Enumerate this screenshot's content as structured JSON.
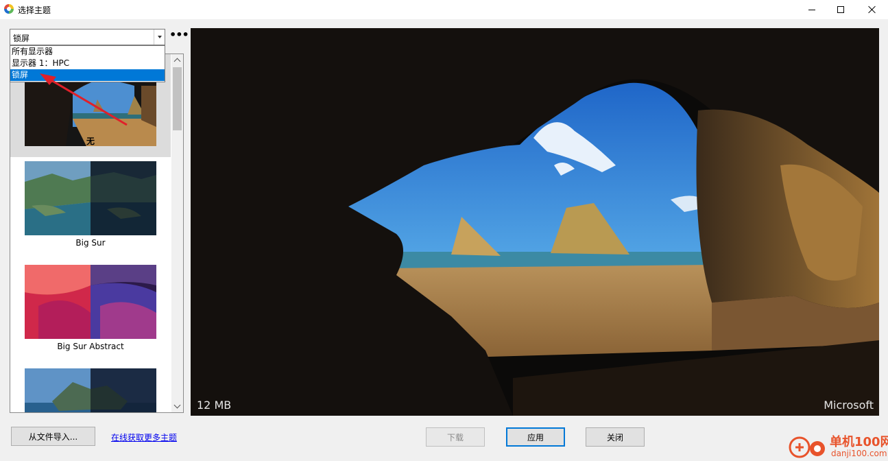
{
  "window": {
    "title": "选择主题",
    "buttons": [
      "minimize",
      "maximize",
      "close"
    ]
  },
  "monitor_select": {
    "value": "锁屏",
    "options": [
      "所有显示器",
      "显示器 1：HPC",
      "锁屏"
    ],
    "selected_index": 2,
    "more_label": "•••"
  },
  "theme_list": {
    "items": [
      {
        "label": "无",
        "selected": true
      },
      {
        "label": "Big Sur",
        "selected": false
      },
      {
        "label": "Big Sur Abstract",
        "selected": false
      },
      {
        "label": "",
        "selected": false
      }
    ]
  },
  "preview": {
    "size_text": "12 MB",
    "source_text": "Microsoft"
  },
  "footer": {
    "import_label": "从文件导入...",
    "more_themes_link": "在线获取更多主题",
    "download_label": "下载",
    "apply_label": "应用",
    "close_label": "关闭"
  },
  "watermark": {
    "title": "单机100网",
    "url": "danji100.com"
  },
  "colors": {
    "accent": "#0078d7",
    "annotation_arrow": "#e0202a",
    "watermark": "#e8532b"
  }
}
